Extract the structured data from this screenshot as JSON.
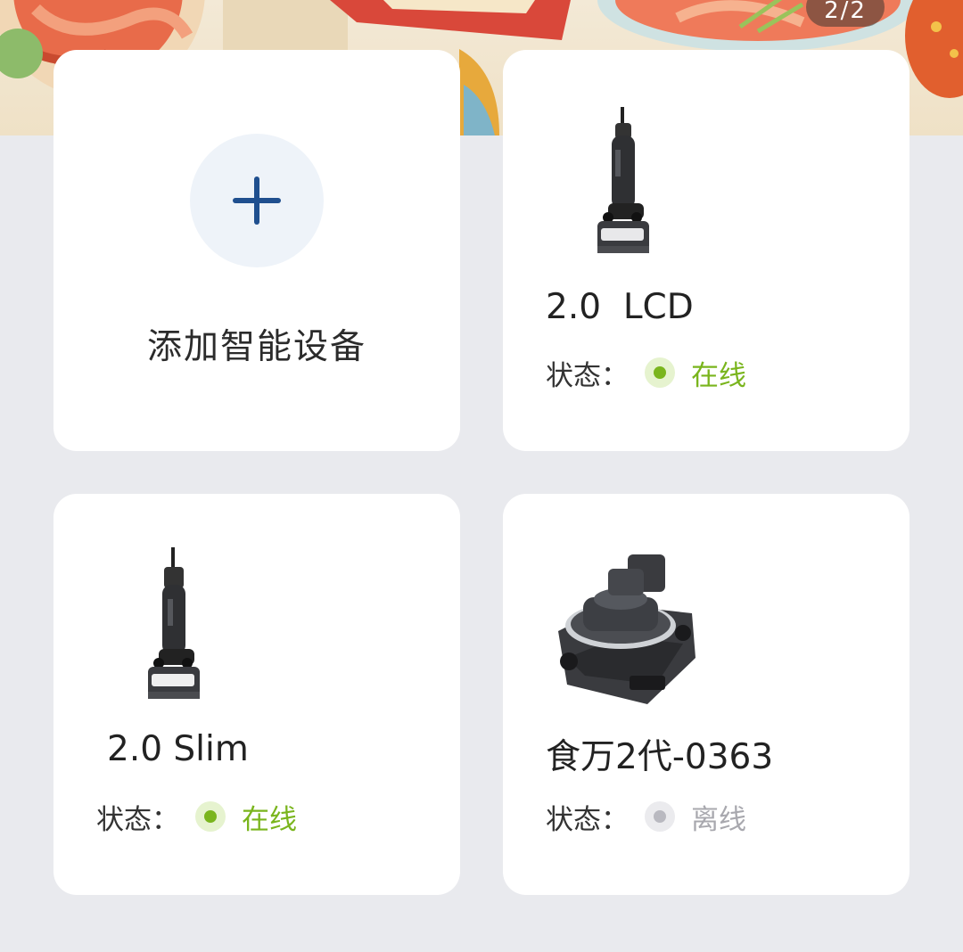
{
  "banner": {
    "page_indicator": "2/2"
  },
  "add_card": {
    "label": "添加智能设备"
  },
  "devices": [
    {
      "name": "2.0  LCD",
      "status_label": "状态：",
      "status": "在线",
      "online": true,
      "image_icon": "vacuum-cleaner-icon"
    },
    {
      "name": "2.0 Slim",
      "status_label": "状态：",
      "status": "在线",
      "online": true,
      "image_icon": "vacuum-cleaner-icon"
    },
    {
      "name": "食万2代-0363",
      "status_label": "状态：",
      "status": "离线",
      "online": false,
      "image_icon": "cooking-machine-icon"
    }
  ],
  "colors": {
    "online": "#7ab51d",
    "offline": "#a8a8ae",
    "add_icon": "#1f4f8f",
    "background": "#e9eaee"
  }
}
